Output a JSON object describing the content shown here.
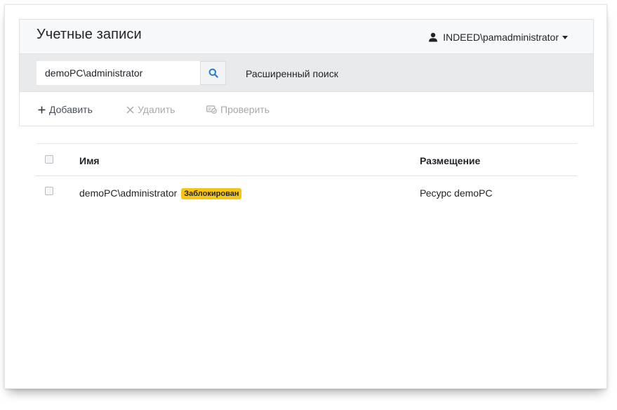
{
  "header": {
    "title": "Учетные записи",
    "user": "INDEED\\pamadministrator"
  },
  "search": {
    "value": "demoPC\\administrator",
    "advanced_label": "Расширенный поиск"
  },
  "toolbar": {
    "add_label": "Добавить",
    "delete_label": "Удалить",
    "check_label": "Проверить"
  },
  "table": {
    "columns": [
      "Имя",
      "Размещение"
    ],
    "rows": [
      {
        "name": "demoPC\\administrator",
        "badge": "Заблокирован",
        "location": "Ресурс demoPC"
      }
    ]
  },
  "colors": {
    "badge": "#f5c518",
    "search_icon": "#1f7bd6",
    "disabled_text": "#a5a9ad"
  },
  "icons": {
    "user": "user-icon",
    "search": "search-icon",
    "add": "plus-icon",
    "delete": "close-icon",
    "check": "check-account-icon"
  }
}
